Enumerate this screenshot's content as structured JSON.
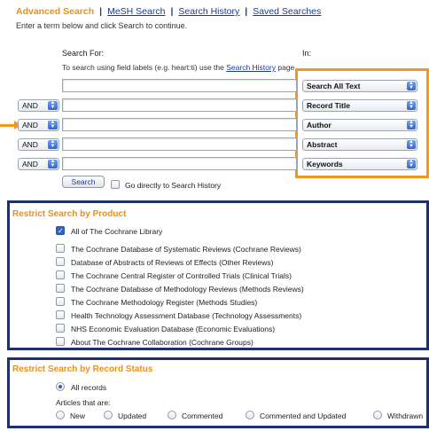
{
  "nav": {
    "items": [
      "Advanced Search",
      "MeSH Search",
      "Search History",
      "Saved Searches"
    ]
  },
  "intro": "Enter a term below and click Search to continue.",
  "search": {
    "search_for_label": "Search For:",
    "in_label": "In:",
    "hint_prefix": "To search using field labels (e.g. heart:ti) use the",
    "hint_link": "Search History",
    "hint_suffix": "page.",
    "boolean_options": [
      "AND",
      "AND",
      "AND",
      "AND"
    ],
    "field_options": [
      "Search All Text",
      "Record Title",
      "Author",
      "Abstract",
      "Keywords"
    ],
    "search_button": "Search",
    "go_history_label": "Go directly to Search History"
  },
  "product": {
    "title": "Restrict Search by Product",
    "all_label": "All of The Cochrane Library",
    "items": [
      "The Cochrane Database of Systematic Reviews (Cochrane Reviews)",
      "Database of Abstracts of Reviews of Effects (Other Reviews)",
      "The Cochrane Central Register of Controlled Trials (Clinical Trials)",
      "The Cochrane Database of Methodology Reviews (Methods Reviews)",
      "The Cochrane Methodology Register (Methods Studies)",
      "Health Technology Assessment Database (Technology Assessments)",
      "NHS Economic Evaluation Database (Economic Evaluations)",
      "About The Cochrane Collaboration (Cochrane Groups)"
    ]
  },
  "status": {
    "title": "Restrict Search by Record Status",
    "all_records": "All records",
    "articles_label": "Articles that are:",
    "options": [
      "New",
      "Updated",
      "Commented",
      "Commented and Updated",
      "Withdrawn"
    ]
  },
  "colors": {
    "accent_orange": "#ef9a1f",
    "frame_navy": "#1d2f6d",
    "link_blue": "#1a3a9a"
  }
}
